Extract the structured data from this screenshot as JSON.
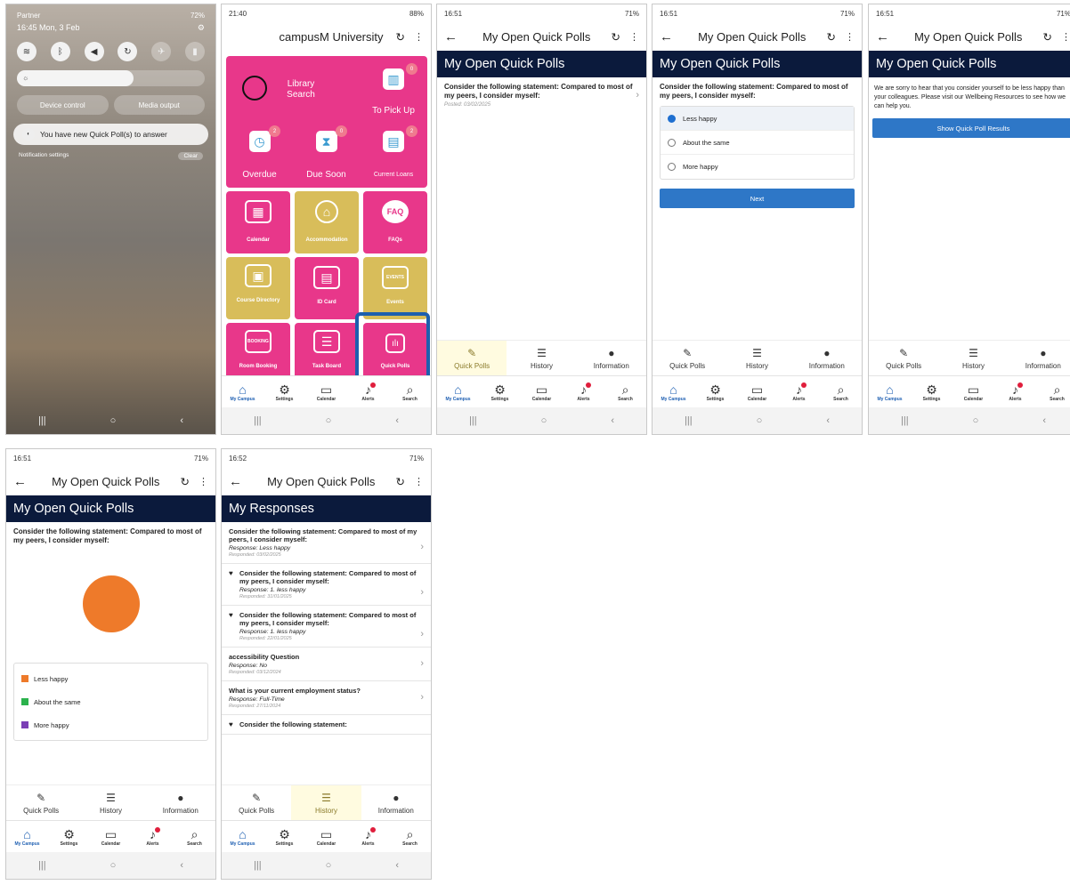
{
  "screen1": {
    "carrier": "Partner",
    "status_right": "72%",
    "time_date": "16:45 Mon, 3 Feb",
    "device_control": "Device control",
    "media_output": "Media output",
    "notification": "You have new Quick Poll(s) to answer",
    "notification_settings": "Notification settings",
    "clear": "Clear"
  },
  "screen2": {
    "status_time": "21:40",
    "status_right": "88%",
    "title": "campusM University",
    "tiles": {
      "library_search": "Library Search",
      "to_pick_up": "To Pick Up",
      "to_pick_up_badge": "0",
      "overdue": "Overdue",
      "overdue_badge": "2",
      "due_soon": "Due Soon",
      "due_soon_badge": "0",
      "current_loans": "Current Loans",
      "current_loans_badge": "2",
      "calendar": "Calendar",
      "accommodation": "Accommodation",
      "faqs": "FAQs",
      "faq_icon": "FAQ",
      "course_directory": "Course Directory",
      "id_card": "ID Card",
      "events": "Events",
      "events_icon": "EVENTS",
      "room_booking": "Room Booking",
      "booking_icon": "BOOKING",
      "task_board": "Task Board",
      "quick_polls": "Quick Polls"
    }
  },
  "common": {
    "screen_title": "My Open Quick Polls",
    "question": "Consider the following statement: Compared to most of my peers, I consider myself:",
    "tab_quick_polls": "Quick Polls",
    "tab_history": "History",
    "tab_information": "Information",
    "nav": {
      "my_campus": "My Campus",
      "settings": "Settings",
      "calendar": "Calendar",
      "alerts": "Alerts",
      "search": "Search"
    }
  },
  "screen3": {
    "status_time": "16:51",
    "status_right": "71%",
    "posted": "Posted: 03/02/2025"
  },
  "screen4": {
    "status_time": "16:51",
    "status_right": "71%",
    "options": [
      "Less happy",
      "About the same",
      "More happy"
    ],
    "next": "Next"
  },
  "screen5": {
    "status_time": "16:51",
    "status_right": "71%",
    "message": "We are sorry to hear that you consider yourself to be less happy than your colleagues. Please visit our Wellbeing Resources to see how we can help you.",
    "button": "Show Quick Poll Results"
  },
  "screen6": {
    "status_time": "16:51",
    "status_right": "71%",
    "legend": [
      "Less happy",
      "About the same",
      "More happy"
    ],
    "colors": {
      "less_happy": "#ee7a2a",
      "about_same": "#2bb24c",
      "more_happy": "#7b3fb5"
    }
  },
  "screen7": {
    "status_time": "16:52",
    "status_right": "71%",
    "header": "My Responses",
    "responses": [
      {
        "q": "Consider the following statement: Compared to most of my peers, I consider myself:",
        "r": "Response: Less happy",
        "d": "Responded: 03/02/2025"
      },
      {
        "q": "Consider the following statement: Compared to most of my peers, I consider myself:",
        "r": "Response: 1. less happy",
        "d": "Responded: 31/01/2025"
      },
      {
        "q": "Consider the following statement: Compared to most of my peers, I consider myself:",
        "r": "Response: 1. less happy",
        "d": "Responded: 22/01/2025"
      },
      {
        "q": "accessibility Question",
        "r": "Response: No",
        "d": "Responded: 03/12/2024"
      },
      {
        "q": "What is your current employment status?",
        "r": "Response: Full-Time",
        "d": "Responded: 27/11/2024"
      },
      {
        "q": "Consider the following statement:",
        "r": "",
        "d": ""
      }
    ]
  }
}
